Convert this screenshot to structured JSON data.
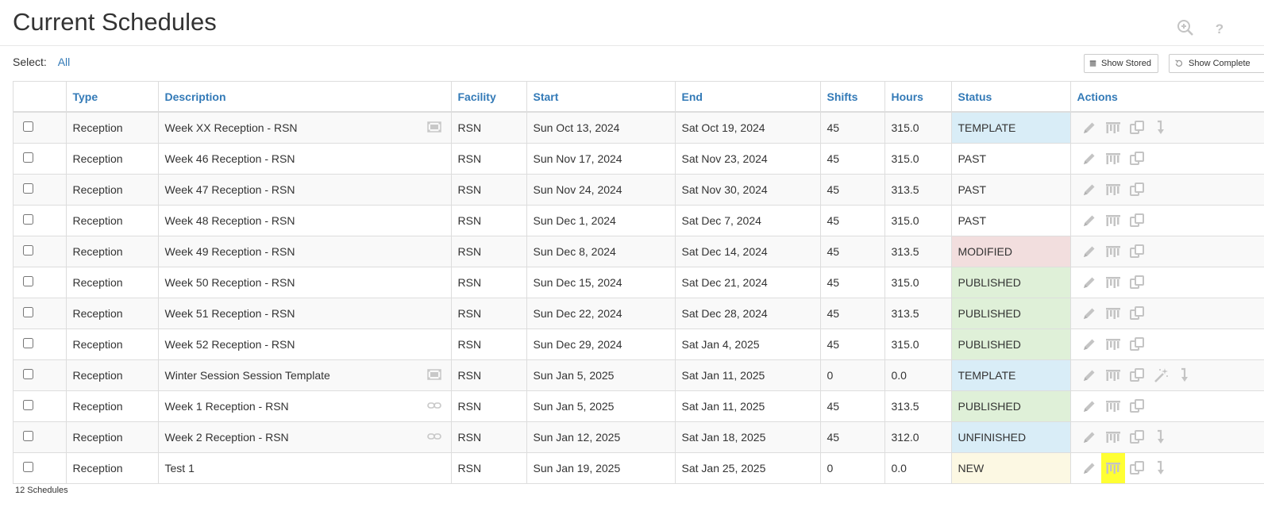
{
  "page": {
    "title": "Current Schedules",
    "zoom_icon": "zoom-in-icon",
    "help_icon": "help-icon"
  },
  "select": {
    "label": "Select:",
    "all_link": "All"
  },
  "toolbar": {
    "show_stored": "Show Stored",
    "show_complete": "Show Complete"
  },
  "table": {
    "headers": {
      "type": "Type",
      "description": "Description",
      "facility": "Facility",
      "start": "Start",
      "end": "End",
      "shifts": "Shifts",
      "hours": "Hours",
      "status": "Status",
      "actions": "Actions"
    },
    "rows": [
      {
        "type": "Reception",
        "description": "Week XX Reception - RSN",
        "desc_icon": "template-icon",
        "facility": "RSN",
        "start": "Sun Oct 13, 2024",
        "end": "Sat Oct 19, 2024",
        "shifts": "45",
        "hours": "315.0",
        "status": "TEMPLATE",
        "status_class": "st-template",
        "actions": [
          "edit",
          "view",
          "copy",
          "move"
        ]
      },
      {
        "type": "Reception",
        "description": "Week 46 Reception - RSN",
        "desc_icon": "",
        "facility": "RSN",
        "start": "Sun Nov 17, 2024",
        "end": "Sat Nov 23, 2024",
        "shifts": "45",
        "hours": "315.0",
        "status": "PAST",
        "status_class": "st-past",
        "actions": [
          "edit",
          "view",
          "copy"
        ]
      },
      {
        "type": "Reception",
        "description": "Week 47 Reception - RSN",
        "desc_icon": "",
        "facility": "RSN",
        "start": "Sun Nov 24, 2024",
        "end": "Sat Nov 30, 2024",
        "shifts": "45",
        "hours": "313.5",
        "status": "PAST",
        "status_class": "st-past",
        "actions": [
          "edit",
          "view",
          "copy"
        ]
      },
      {
        "type": "Reception",
        "description": "Week 48 Reception - RSN",
        "desc_icon": "",
        "facility": "RSN",
        "start": "Sun Dec 1, 2024",
        "end": "Sat Dec 7, 2024",
        "shifts": "45",
        "hours": "315.0",
        "status": "PAST",
        "status_class": "st-past",
        "actions": [
          "edit",
          "view",
          "copy"
        ]
      },
      {
        "type": "Reception",
        "description": "Week 49 Reception - RSN",
        "desc_icon": "",
        "facility": "RSN",
        "start": "Sun Dec 8, 2024",
        "end": "Sat Dec 14, 2024",
        "shifts": "45",
        "hours": "313.5",
        "status": "MODIFIED",
        "status_class": "st-modified",
        "actions": [
          "edit",
          "view",
          "copy"
        ]
      },
      {
        "type": "Reception",
        "description": "Week 50 Reception - RSN",
        "desc_icon": "",
        "facility": "RSN",
        "start": "Sun Dec 15, 2024",
        "end": "Sat Dec 21, 2024",
        "shifts": "45",
        "hours": "315.0",
        "status": "PUBLISHED",
        "status_class": "st-published",
        "actions": [
          "edit",
          "view",
          "copy"
        ]
      },
      {
        "type": "Reception",
        "description": "Week 51 Reception - RSN",
        "desc_icon": "",
        "facility": "RSN",
        "start": "Sun Dec 22, 2024",
        "end": "Sat Dec 28, 2024",
        "shifts": "45",
        "hours": "313.5",
        "status": "PUBLISHED",
        "status_class": "st-published",
        "actions": [
          "edit",
          "view",
          "copy"
        ]
      },
      {
        "type": "Reception",
        "description": "Week 52 Reception - RSN",
        "desc_icon": "",
        "facility": "RSN",
        "start": "Sun Dec 29, 2024",
        "end": "Sat Jan 4, 2025",
        "shifts": "45",
        "hours": "315.0",
        "status": "PUBLISHED",
        "status_class": "st-published",
        "actions": [
          "edit",
          "view",
          "copy"
        ]
      },
      {
        "type": "Reception",
        "description": "Winter Session Session Template",
        "desc_icon": "template-icon",
        "facility": "RSN",
        "start": "Sun Jan 5, 2025",
        "end": "Sat Jan 11, 2025",
        "shifts": "0",
        "hours": "0.0",
        "status": "TEMPLATE",
        "status_class": "st-template",
        "actions": [
          "edit",
          "view",
          "copy",
          "wand",
          "move"
        ]
      },
      {
        "type": "Reception",
        "description": "Week 1 Reception - RSN",
        "desc_icon": "link-icon",
        "facility": "RSN",
        "start": "Sun Jan 5, 2025",
        "end": "Sat Jan 11, 2025",
        "shifts": "45",
        "hours": "313.5",
        "status": "PUBLISHED",
        "status_class": "st-published",
        "actions": [
          "edit",
          "view",
          "copy"
        ]
      },
      {
        "type": "Reception",
        "description": "Week 2 Reception - RSN",
        "desc_icon": "link-icon",
        "facility": "RSN",
        "start": "Sun Jan 12, 2025",
        "end": "Sat Jan 18, 2025",
        "shifts": "45",
        "hours": "312.0",
        "status": "UNFINISHED",
        "status_class": "st-unfinished",
        "actions": [
          "edit",
          "view",
          "copy",
          "move"
        ]
      },
      {
        "type": "Reception",
        "description": "Test 1",
        "desc_icon": "",
        "facility": "RSN",
        "start": "Sun Jan 19, 2025",
        "end": "Sat Jan 25, 2025",
        "shifts": "0",
        "hours": "0.0",
        "status": "NEW",
        "status_class": "st-new",
        "actions": [
          "edit",
          "view",
          "copy",
          "move"
        ],
        "highlight_action": "view"
      }
    ]
  },
  "footer": {
    "count": "12 Schedules"
  },
  "colors": {
    "link": "#337ab7",
    "template": "#d9edf7",
    "modified": "#f2dede",
    "published": "#dff0d8",
    "new": "#fcf8e3",
    "highlight": "#ffff33",
    "icon_gray": "#c4c4c4"
  }
}
